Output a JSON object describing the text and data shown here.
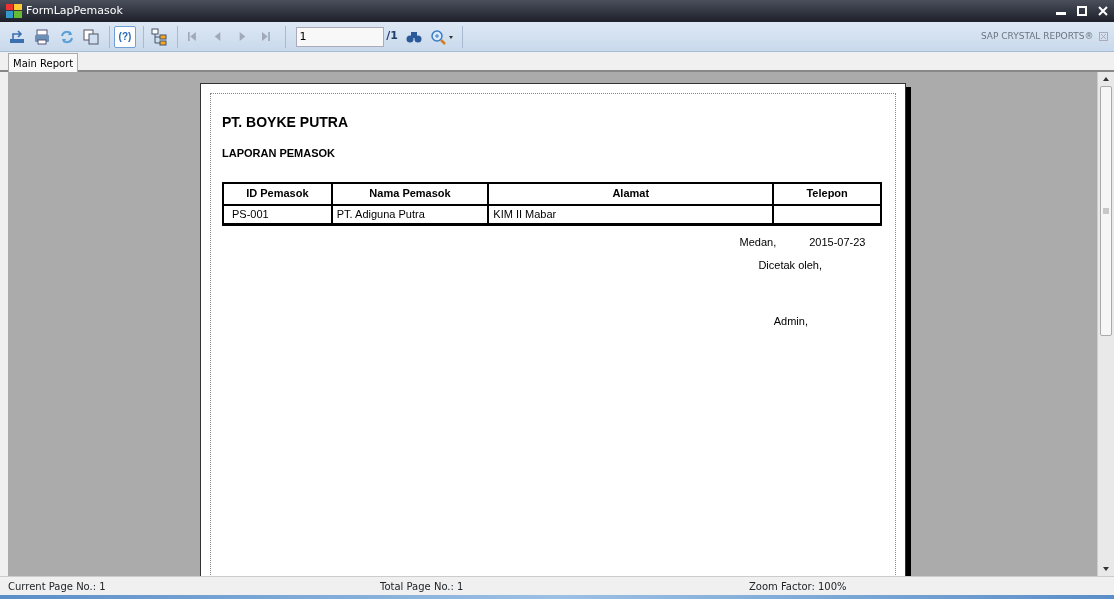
{
  "window": {
    "title": "FormLapPemasok"
  },
  "toolbar": {
    "buttons": [
      {
        "kind": "export",
        "disabled": false,
        "on": false
      },
      {
        "kind": "print",
        "disabled": false,
        "on": false
      },
      {
        "kind": "refresh",
        "disabled": false,
        "on": false
      },
      {
        "kind": "copy",
        "disabled": false,
        "on": false
      },
      {
        "kind": "help",
        "label": "(?)",
        "disabled": false,
        "on": true
      },
      {
        "kind": "tree",
        "disabled": false,
        "on": false
      },
      {
        "kind": "first",
        "disabled": true,
        "on": false
      },
      {
        "kind": "prev",
        "disabled": true,
        "on": false
      },
      {
        "kind": "next",
        "disabled": true,
        "on": false
      },
      {
        "kind": "last",
        "disabled": true,
        "on": false
      }
    ],
    "page_value": "1",
    "page_total": "/1",
    "brand": "SAP CRYSTAL REPORTS®"
  },
  "tabs": [
    {
      "label": "Main Report",
      "selected": true
    }
  ],
  "report": {
    "company": "PT. BOYKE PUTRA",
    "title": "LAPORAN PEMASOK",
    "columns": [
      "ID Pemasok",
      "Nama Pemasok",
      "Alamat",
      "Telepon"
    ],
    "rows": [
      [
        "PS-001",
        "PT. Adiguna Putra",
        "KIM II Mabar",
        ""
      ]
    ],
    "city": "Medan,",
    "date": "2015-07-23",
    "printed_by": "Dicetak oleh,",
    "signer": "Admin,"
  },
  "status_bar": [
    "Current Page No.: 1",
    "Total Page No.: 1",
    "Zoom Factor: 100%"
  ]
}
